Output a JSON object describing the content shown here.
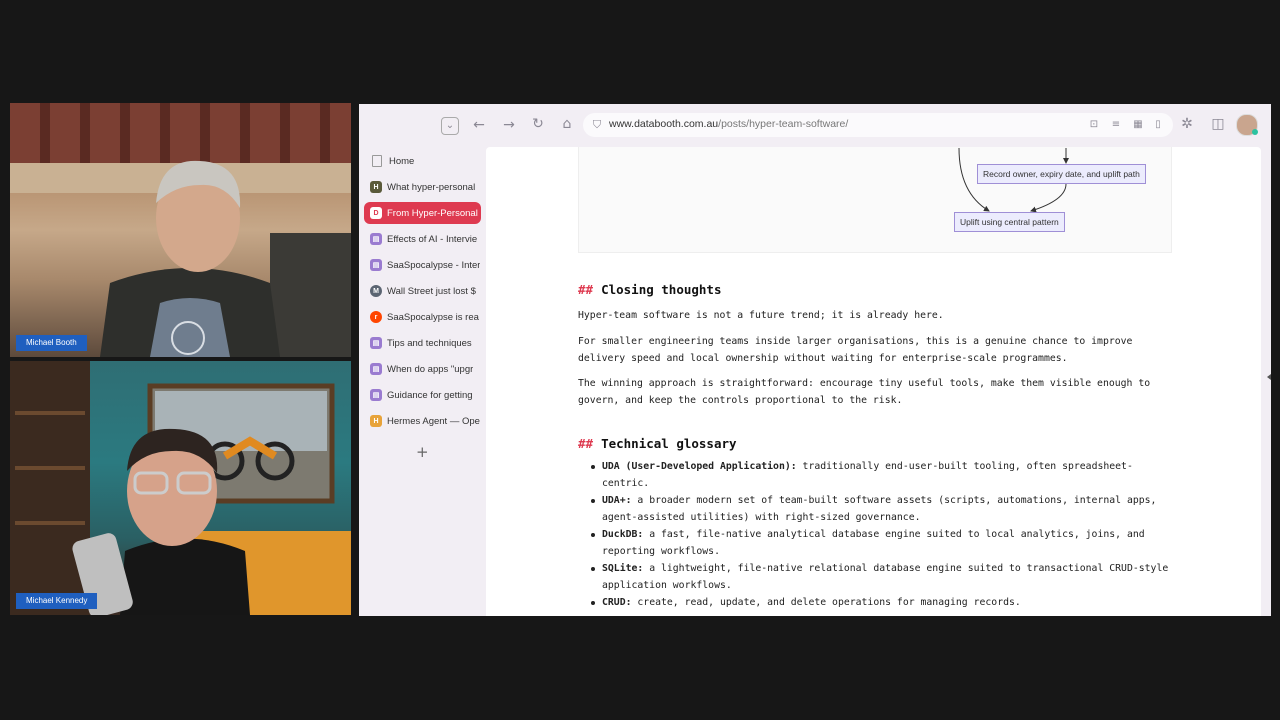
{
  "participants": [
    {
      "name": "Michael Booth"
    },
    {
      "name": "Michael Kennedy"
    }
  ],
  "browser": {
    "url_host": "www.databooth.com.au",
    "url_path": "/posts/hyper-team-software/"
  },
  "sidebar": {
    "items": [
      {
        "label": "Home",
        "favicon": "page-icon"
      },
      {
        "label": "What hyper-personal",
        "favicon": "hn-icon"
      },
      {
        "label": "From Hyper-Personal",
        "favicon": "databooth-icon"
      },
      {
        "label": "Effects of AI - Intervie",
        "favicon": "substack-icon"
      },
      {
        "label": "SaaSpocalypse - Inter",
        "favicon": "substack-icon"
      },
      {
        "label": "Wall Street just lost $",
        "favicon": "medium-icon"
      },
      {
        "label": "SaaSpocalypse is rea",
        "favicon": "reddit-icon"
      },
      {
        "label": "Tips and techniques",
        "favicon": "substack-icon"
      },
      {
        "label": "When do apps \"upgr",
        "favicon": "substack-icon"
      },
      {
        "label": "Guidance for getting",
        "favicon": "substack-icon"
      },
      {
        "label": "Hermes Agent — Ope",
        "favicon": "hermes-icon"
      }
    ]
  },
  "diagram": {
    "node_record": "Record owner, expiry date, and uplift path",
    "node_uplift": "Uplift using central pattern"
  },
  "article": {
    "h_closing": "Closing thoughts",
    "hash": "##",
    "p1": "Hyper-team software is not a future trend; it is already here.",
    "p2": "For smaller engineering teams inside larger organisations, this is a genuine chance to improve delivery speed and local ownership without waiting for enterprise-scale programmes.",
    "p3": "The winning approach is straightforward: encourage tiny useful tools, make them visible enough to govern, and keep the controls proportional to the risk.",
    "h_glossary": "Technical glossary",
    "glossary": [
      {
        "term": "UDA (User-Developed Application):",
        "def": " traditionally end-user-built tooling, often spreadsheet-centric."
      },
      {
        "term": "UDA+:",
        "def": " a broader modern set of team-built software assets (scripts, automations, internal apps, agent-assisted utilities) with right-sized governance."
      },
      {
        "term": "DuckDB:",
        "def": " a fast, file-native analytical database engine suited to local analytics, joins, and reporting workflows."
      },
      {
        "term": "SQLite:",
        "def": " a lightweight, file-native relational database engine suited to transactional CRUD-style application workflows."
      },
      {
        "term": "CRUD:",
        "def": " create, read, update, and delete operations for managing records."
      }
    ]
  },
  "colors": {
    "accent": "#de3a50",
    "name_tag": "#1f5fbf",
    "node_fill": "#ececfd",
    "node_border": "#9f8fd6"
  }
}
